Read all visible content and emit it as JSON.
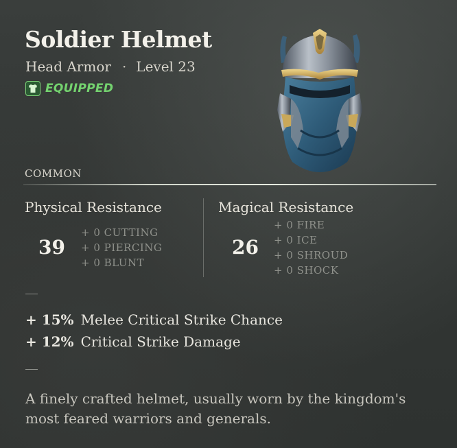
{
  "item": {
    "name": "Soldier Helmet",
    "category": "Head Armor",
    "separator": "·",
    "level": "Level 23",
    "status": "EQUIPPED",
    "status_icon": "shirt-icon",
    "rarity": "COMMON"
  },
  "physical": {
    "title": "Physical Resistance",
    "value": "39",
    "subs": [
      "+ 0 CUTTING",
      "+ 0 PIERCING",
      "+ 0 BLUNT"
    ]
  },
  "magical": {
    "title": "Magical Resistance",
    "value": "26",
    "subs": [
      "+ 0 FIRE",
      "+ 0 ICE",
      "+ 0 SHROUD",
      "+ 0 SHOCK"
    ]
  },
  "bonuses": [
    {
      "amount": "+ 15%",
      "label": "Melee Critical Strike Chance"
    },
    {
      "amount": "+ 12%",
      "label": "Critical Strike Damage"
    }
  ],
  "description": "A finely crafted helmet, usually worn by the kingdom's most feared warriors and generals.",
  "colors": {
    "equipped": "#74d36f",
    "helmet_steel": "#b9c0c8",
    "helmet_gold": "#c9a85a",
    "helmet_cloth": "#2e5b78"
  }
}
